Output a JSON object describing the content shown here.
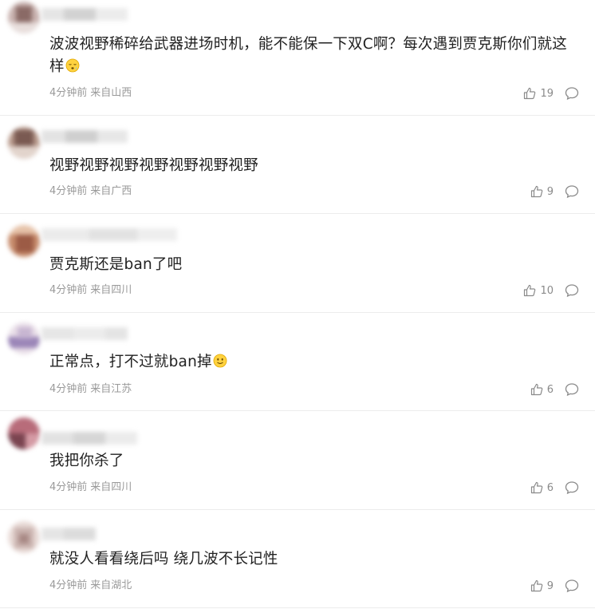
{
  "comments": [
    {
      "text": "波波视野稀碎给武器进场时机，能不能保一下双C啊？每次遇到贾克斯你们就这样",
      "emoji": "sleepy-face-icon",
      "time": "4分钟前",
      "location": "来自山西",
      "likes": "19",
      "avatar_colors": [
        "#c9b3b0",
        "#8a6a66",
        "#e8dedc"
      ]
    },
    {
      "text": "视野视野视野视野视野视野视野",
      "emoji": "",
      "time": "4分钟前",
      "location": "来自广西",
      "likes": "9",
      "avatar_colors": [
        "#b89a8c",
        "#7a5a52",
        "#e2d4cc"
      ]
    },
    {
      "text": "贾克斯还是ban了吧",
      "emoji": "",
      "time": "4分钟前",
      "location": "来自四川",
      "likes": "10",
      "avatar_colors": [
        "#c78c6c",
        "#e6c2a8",
        "#9c5b45"
      ]
    },
    {
      "text": "正常点，打不过就ban掉",
      "emoji": "slight-smile-icon",
      "time": "4分钟前",
      "location": "来自江苏",
      "likes": "6",
      "avatar_colors": [
        "#c8b6d2",
        "#e9dfe8",
        "#9b86b8"
      ]
    },
    {
      "text": "我把你杀了",
      "emoji": "",
      "time": "4分钟前",
      "location": "来自四川",
      "likes": "6",
      "avatar_colors": [
        "#7a4450",
        "#d49aa4",
        "#b86c7a"
      ]
    },
    {
      "text": "就没人看看绕后吗 绕几波不长记性",
      "emoji": "",
      "time": "4分钟前",
      "location": "来自湖北",
      "likes": "9",
      "avatar_colors": [
        "#c9b2ae",
        "#e8dad6",
        "#a88884"
      ]
    }
  ],
  "colors": {
    "text": "#222222",
    "meta": "#9a9a9a",
    "divider": "#ececec",
    "icon": "#8a8a8a",
    "emoji_face": "#ffd23f"
  }
}
